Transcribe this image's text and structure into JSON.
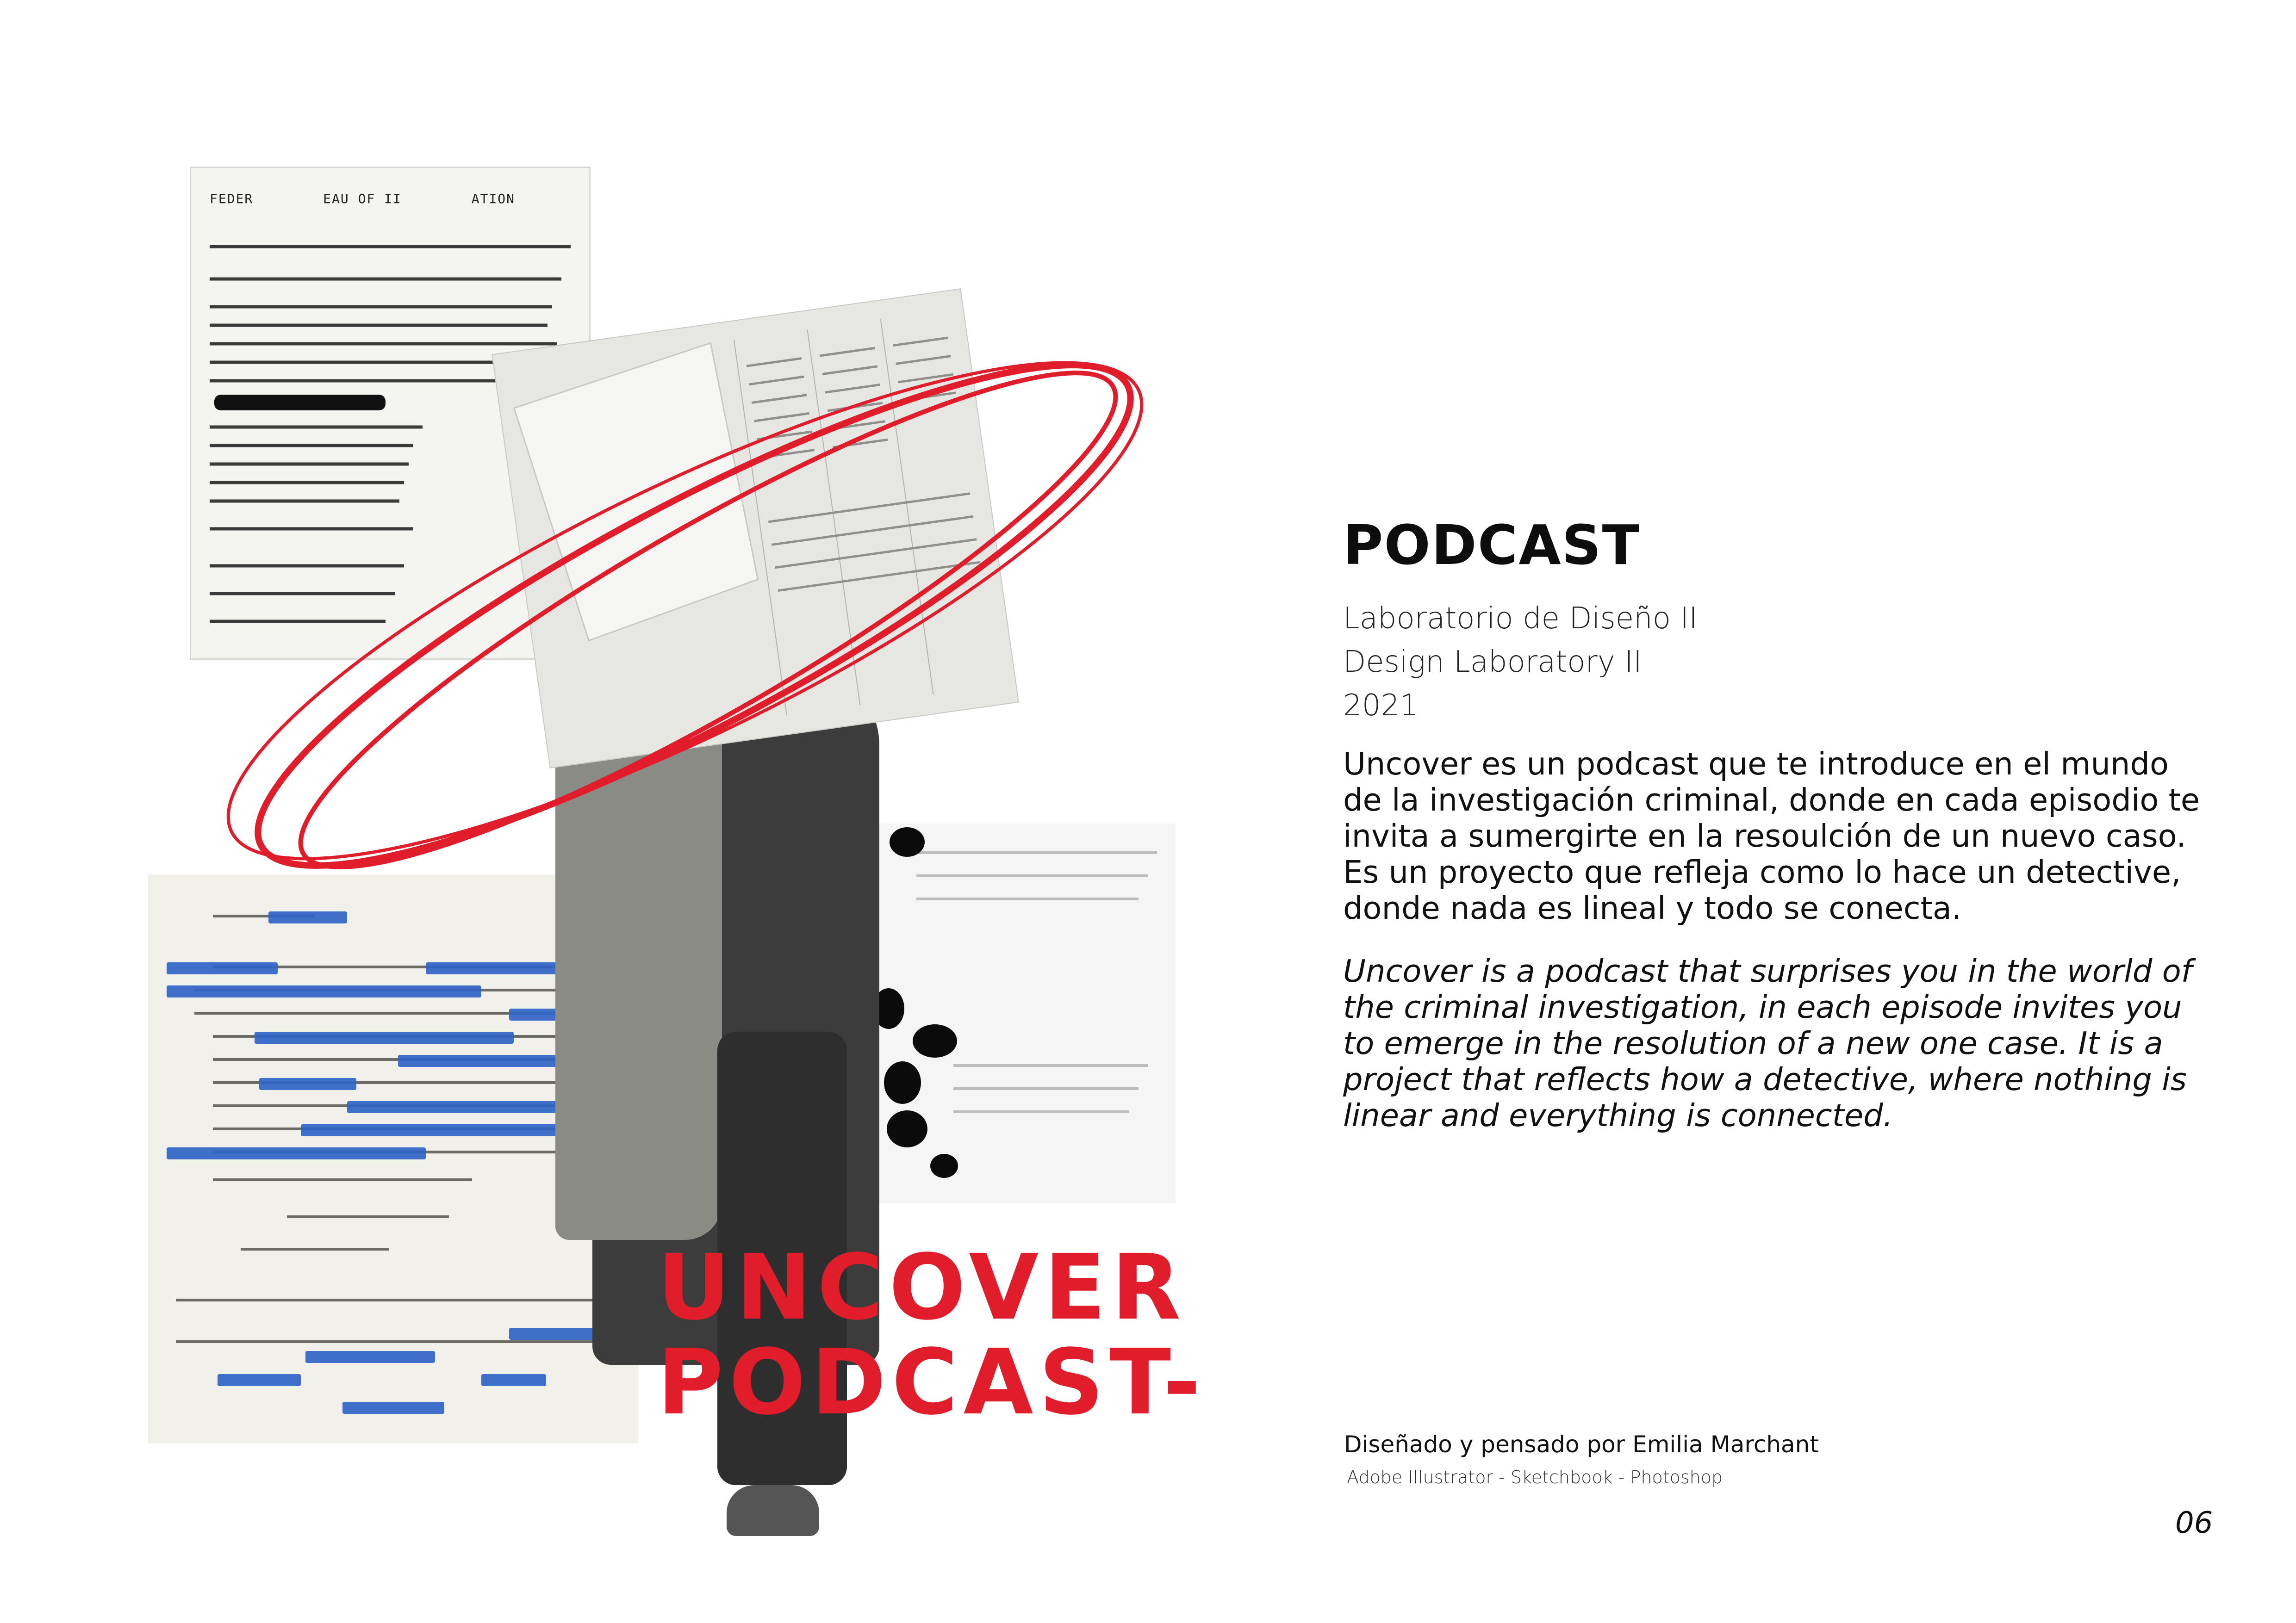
{
  "cover": {
    "line1": "UNCOVER",
    "line2": "PODCAST-",
    "accent_color": "#e21d2b",
    "highlight_color": "#2f64c6",
    "fbi_header": "FEDER        EAU OF II        ATION"
  },
  "project": {
    "title": "PODCAST",
    "course_es": "Laboratorio de Diseño II",
    "course_en": "Design Laboratory II",
    "year": "2021",
    "description_es": "Uncover es un podcast que te introduce en el mundo de la investigación criminal, donde en cada episodio te invita a sumergirte en la resoulción de un nuevo caso. Es un proyecto que refleja como lo hace un detective, donde nada es lineal y todo se conecta.",
    "description_en": "Uncover is a podcast that surprises you in the world of the criminal investigation, in each episode invites you to emerge in the resolution of a new one case. It is a project that reflects how a detective, where nothing is linear and everything is connected."
  },
  "footer": {
    "credit": "Diseñado y pensado por Emilia Marchant",
    "tools": "Adobe Illustrator - Sketchbook - Photoshop",
    "page_number": "06"
  }
}
